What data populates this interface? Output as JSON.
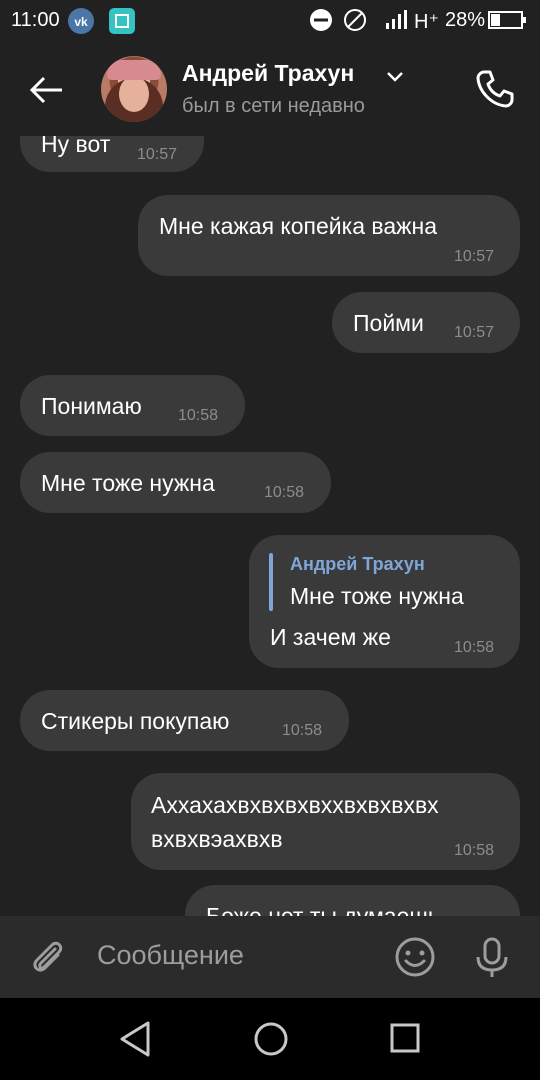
{
  "status_bar": {
    "time": "11:00",
    "network": "H⁺",
    "battery": "28%",
    "icons": [
      "vk-icon",
      "screenshot-icon",
      "dnd-icon",
      "no-sim-icon",
      "signal-icon",
      "battery-icon"
    ]
  },
  "header": {
    "name": "Андрей Трахун",
    "status": "был в сети недавно"
  },
  "messages": [
    {
      "side": "in",
      "text": "Ну вот",
      "time": "10:57"
    },
    {
      "side": "out",
      "text": "Мне кажая копейка важна",
      "time": "10:57"
    },
    {
      "side": "out",
      "text": "Пойми",
      "time": "10:57"
    },
    {
      "side": "in",
      "text": "Понимаю",
      "time": "10:58"
    },
    {
      "side": "in",
      "text": "Мне тоже нужна",
      "time": "10:58"
    },
    {
      "side": "out",
      "reply_name": "Андрей Трахун",
      "reply_text": "Мне тоже нужна",
      "text": "И зачем же",
      "time": "10:58"
    },
    {
      "side": "in",
      "text": "Стикеры покупаю",
      "time": "10:58"
    },
    {
      "side": "out",
      "text_line1": "Аххахахвхвхвхвххвхвхвхвх",
      "text_line2": "вхвхвэахвхв",
      "time": "10:58"
    },
    {
      "side": "out",
      "text": "Боже нет ты думаешь",
      "time": ""
    }
  ],
  "composer": {
    "placeholder": "Сообщение"
  },
  "colors": {
    "background": "#212121",
    "bubble": "#3a3a3a",
    "accent": "#7fa6d8",
    "time": "#8c8c8c"
  }
}
